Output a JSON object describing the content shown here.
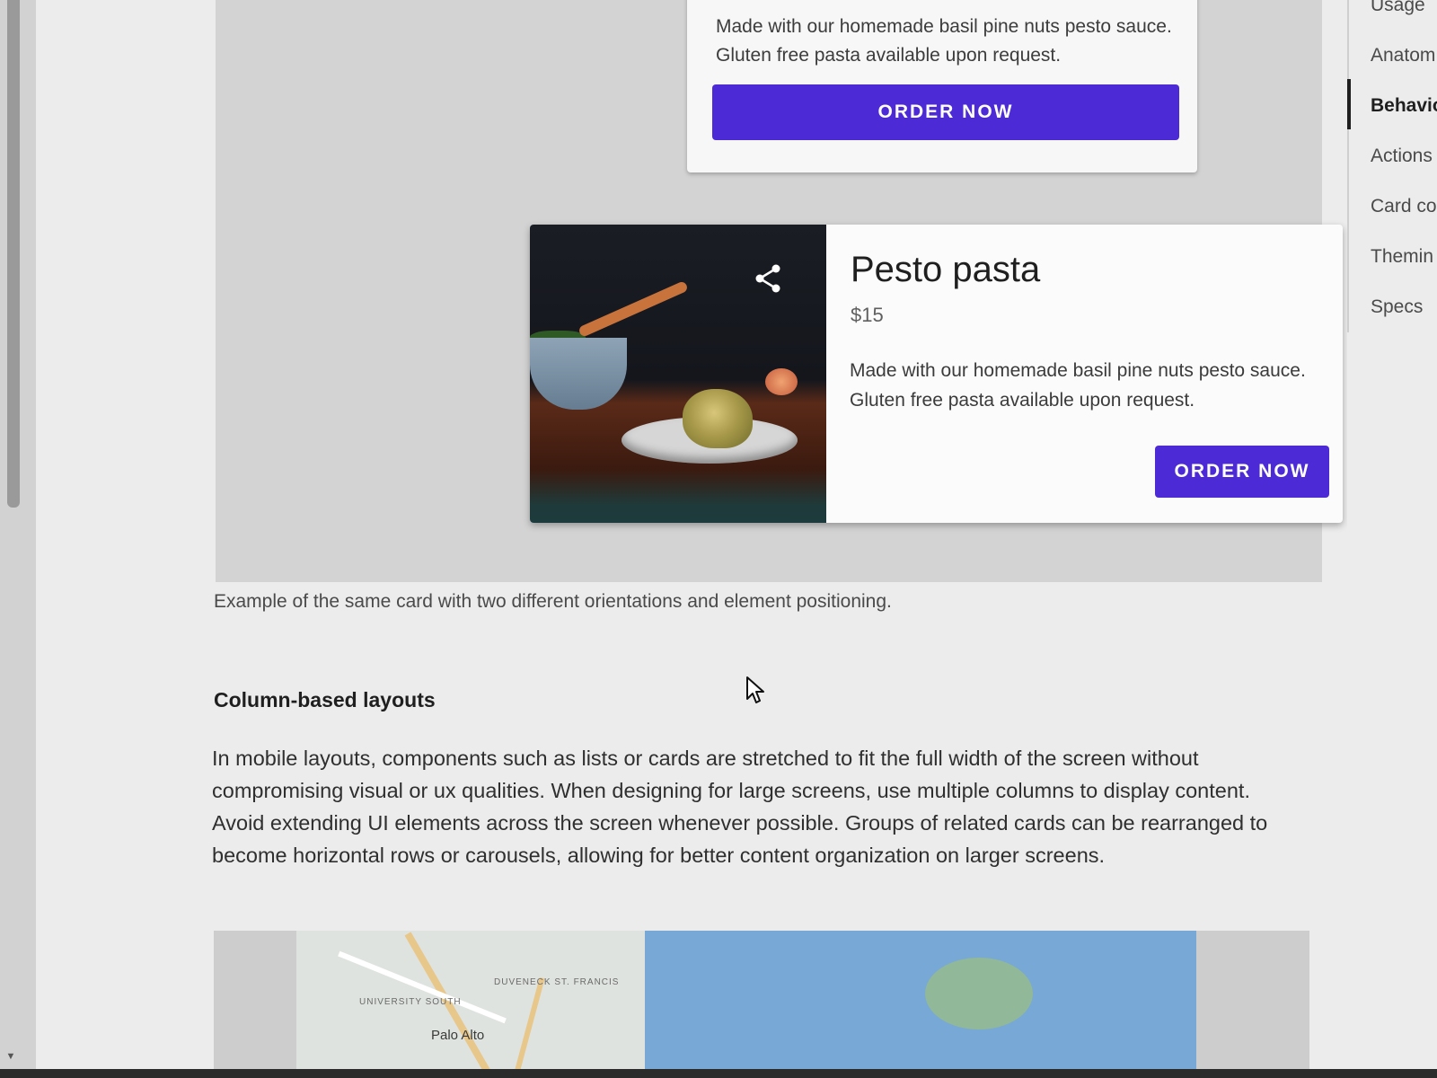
{
  "vertical_card": {
    "description": "Made with our homemade basil pine nuts pesto sauce. Gluten free pasta available upon request.",
    "button_label": "ORDER NOW"
  },
  "horizontal_card": {
    "title": "Pesto pasta",
    "price": "$15",
    "description": "Made with our homemade basil pine nuts pesto sauce. Gluten free pasta available upon request.",
    "button_label": "ORDER NOW",
    "share_icon": "share-icon"
  },
  "caption": "Example of the same card with two different orientations and element positioning.",
  "section": {
    "heading": "Column-based layouts",
    "body": "In mobile layouts, components such as lists or cards are stretched to fit the full width of the screen without compromising visual or ux qualities. When designing for large screens, use multiple columns to display content. Avoid extending UI elements across the screen whenever possible. Groups of related cards can be rearranged to become horizontal rows or carousels, allowing for better content organization on larger screens."
  },
  "map": {
    "labels": [
      "UNIVERSITY SOUTH",
      "DUVENECK ST. FRANCIS",
      "Palo Alto"
    ]
  },
  "toc": {
    "items": [
      "Usage",
      "Anatom",
      "Behavio",
      "Actions",
      "Card co",
      "Themin",
      "Specs"
    ],
    "active_index": 2
  },
  "colors": {
    "primary_button": "#4c2bd6",
    "page_background": "#ececec"
  }
}
